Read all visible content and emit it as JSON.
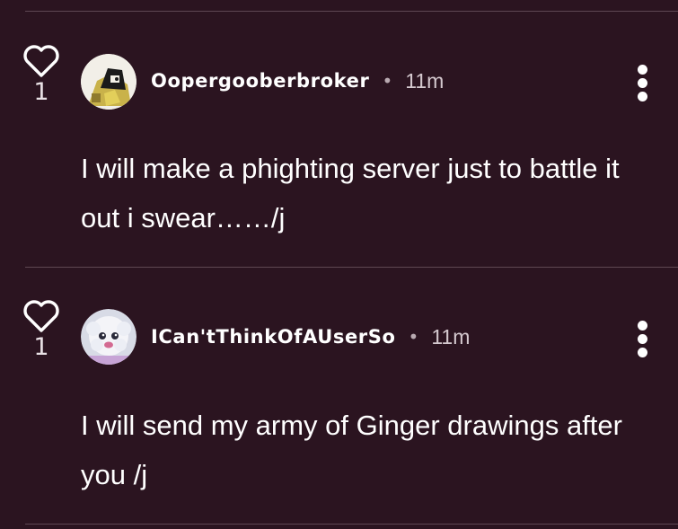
{
  "comments": [
    {
      "likes": "1",
      "username": "Oopergooberbroker",
      "separator": "•",
      "time": "11m",
      "text": "I will make a phighting server just to battle it out i swear……/j",
      "avatar_icon": "avatar-yellow-character-icon"
    },
    {
      "likes": "1",
      "username": "ICan'tThinkOfAUserSo",
      "separator": "•",
      "time": "11m",
      "text": "I will send my army of Ginger drawings after you /j",
      "avatar_icon": "avatar-white-fluffy-character-icon"
    }
  ],
  "colors": {
    "background": "#2b1420",
    "divider": "#5e4752",
    "text": "#ffffff",
    "muted": "#d5c9cf"
  }
}
